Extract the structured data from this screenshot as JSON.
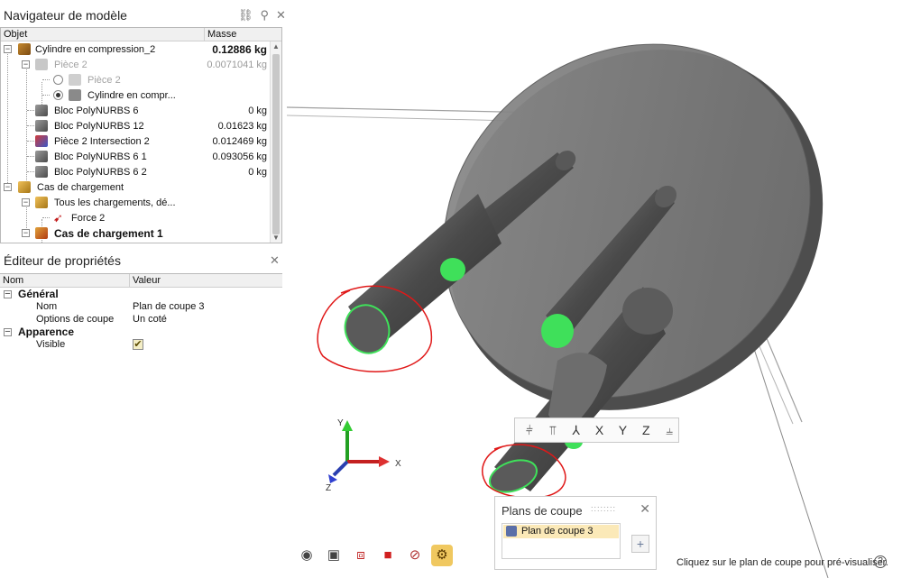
{
  "model_navigator": {
    "title": "Navigateur de modèle",
    "columns": {
      "object": "Objet",
      "mass": "Masse"
    },
    "rows": [
      {
        "label": "Cylindre en compression_2",
        "mass": "0.12886 kg",
        "bold_mass": true
      },
      {
        "label": "Pièce 2",
        "mass": "0.0071041 kg",
        "dimmed": true
      },
      {
        "label": "Pièce 2",
        "mass": "",
        "dimmed": true
      },
      {
        "label": "Cylindre en compr...",
        "mass": ""
      },
      {
        "label": "Bloc PolyNURBS 6",
        "mass": "0 kg"
      },
      {
        "label": "Bloc PolyNURBS 12",
        "mass": "0.01623 kg"
      },
      {
        "label": "Pièce 2 Intersection 2",
        "mass": "0.012469 kg"
      },
      {
        "label": "Bloc PolyNURBS 6 1",
        "mass": "0.093056 kg"
      },
      {
        "label": "Bloc PolyNURBS 6 2",
        "mass": "0 kg"
      },
      {
        "label": "Cas de chargement",
        "mass": ""
      },
      {
        "label": "Tous les chargements, dé...",
        "mass": ""
      },
      {
        "label": "Force 2",
        "mass": ""
      },
      {
        "label": "Cas de chargement  1",
        "mass": "",
        "bold": true
      }
    ]
  },
  "property_editor": {
    "title": "Éditeur de propriétés",
    "columns": {
      "name": "Nom",
      "value": "Valeur"
    },
    "groups": [
      {
        "name": "Général",
        "props": [
          {
            "name": "Nom",
            "value": "Plan de coupe 3"
          },
          {
            "name": "Options de coupe",
            "value": "Un coté"
          }
        ]
      },
      {
        "name": "Apparence",
        "props": [
          {
            "name": "Visible",
            "value": "✔"
          }
        ]
      }
    ]
  },
  "section_toolbar": {
    "buttons": [
      "⫩",
      "⫪",
      "⅄",
      "X",
      "Y",
      "Z",
      "⫨"
    ]
  },
  "cutting_planes": {
    "title": "Plans de coupe",
    "grip": "::::::::",
    "items": [
      "Plan de coupe 3"
    ],
    "add_label": "+"
  },
  "axis_labels": {
    "x": "X",
    "y": "Y",
    "z": "Z"
  },
  "hint": "Cliquez sur le plan de coupe pour pré-visualiser.",
  "help": "?",
  "icons": {
    "nav_tools": [
      "hierarchy-icon",
      "search-icon",
      "close-icon"
    ],
    "bottom_tools": [
      "eye-icon",
      "camera-icon",
      "section-view-icon",
      "red-cube-icon",
      "analysis-icon",
      "gear-coin-icon"
    ]
  },
  "colors": {
    "accent_green": "#3fe05a",
    "annotation_red": "#e01818",
    "selection_yellow": "#fbe9b8"
  }
}
